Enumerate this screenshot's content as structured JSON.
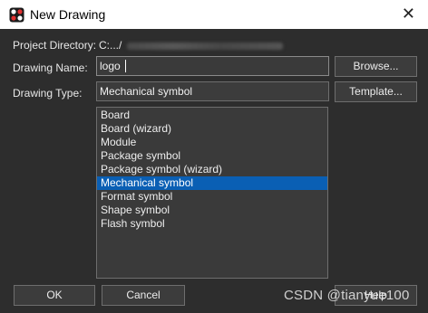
{
  "window": {
    "title": "New Drawing",
    "close_glyph": "✕"
  },
  "form": {
    "project_directory_label": "Project Directory:",
    "project_directory_value": "C:.../",
    "drawing_name_label": "Drawing Name:",
    "drawing_name_value": "logo",
    "drawing_type_label": "Drawing Type:",
    "drawing_type_value": "Mechanical symbol"
  },
  "buttons": {
    "browse": "Browse...",
    "template": "Template...",
    "ok": "OK",
    "cancel": "Cancel",
    "help": "Help"
  },
  "drawing_types": [
    "Board",
    "Board (wizard)",
    "Module",
    "Package symbol",
    "Package symbol (wizard)",
    "Mechanical symbol",
    "Format symbol",
    "Shape symbol",
    "Flash symbol"
  ],
  "selected_index": 5,
  "watermark": "CSDN @tianyue100",
  "colors": {
    "selection": "#0a5fb4",
    "background": "#2d2d2d"
  },
  "icons": {
    "app": "orcad-app-icon",
    "close": "close-icon"
  }
}
